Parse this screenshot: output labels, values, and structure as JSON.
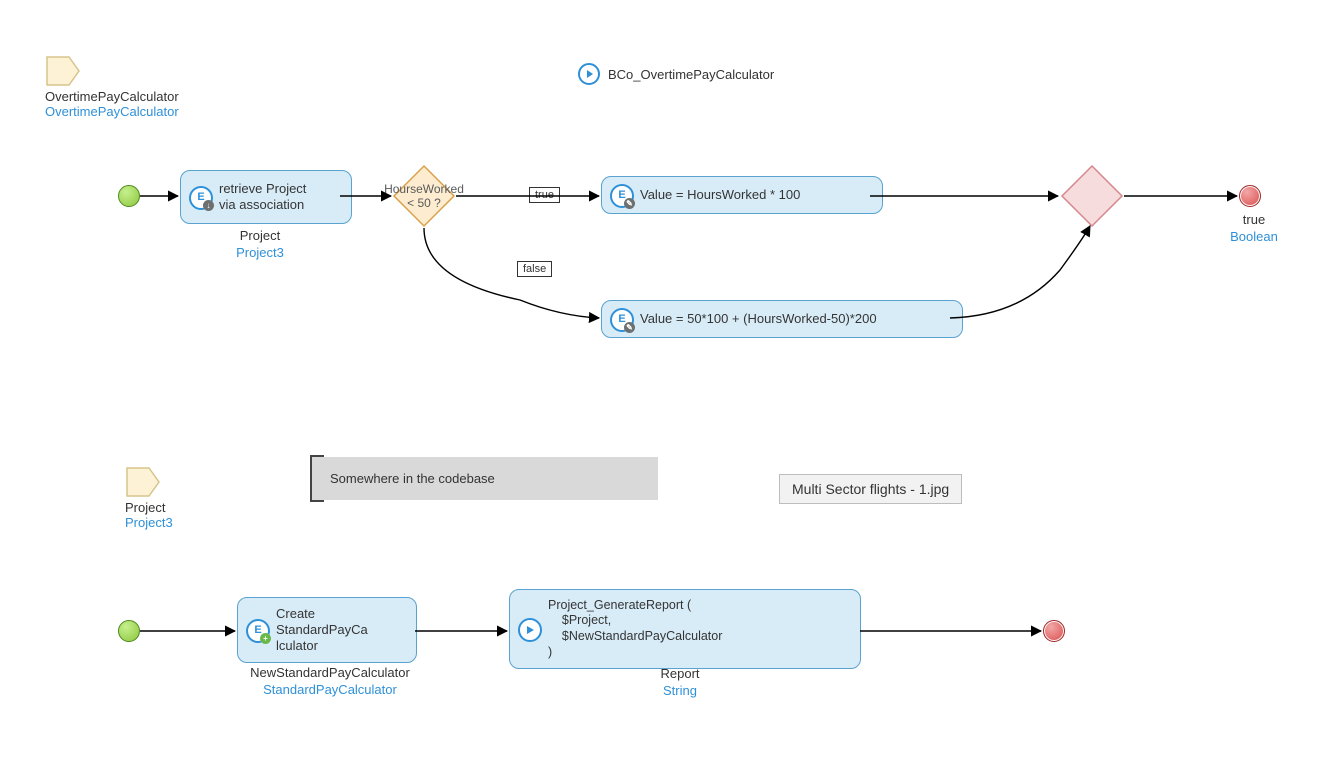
{
  "flow1": {
    "title": "BCo_OvertimePayCalculator",
    "param": {
      "name": "OvertimePayCalculator",
      "type": "OvertimePayCalculator"
    },
    "retrieve": {
      "text": "retrieve Project\nvia association",
      "cap_name": "Project",
      "cap_type": "Project3"
    },
    "decision": {
      "text": "HourseWorked\n< 50 ?"
    },
    "label_true": "true",
    "label_false": "false",
    "actTrue": {
      "text": "Value = HoursWorked * 100"
    },
    "actFalse": {
      "text": "Value = 50*100 + (HoursWorked-50)*200"
    },
    "endLabel": {
      "name": "true",
      "type": "Boolean"
    }
  },
  "flow2": {
    "param": {
      "name": "Project",
      "type": "Project3"
    },
    "annotation": "Somewhere in the codebase",
    "create": {
      "text": "Create\nStandardPayCa\nlculator",
      "cap_name": "NewStandardPayCalculator",
      "cap_type": "StandardPayCalculator"
    },
    "call": {
      "text": "Project_GenerateReport (\n    $Project,\n    $NewStandardPayCalculator\n)",
      "cap_name": "Report",
      "cap_type": "String"
    }
  },
  "file_tip": "Multi Sector flights - 1.jpg"
}
